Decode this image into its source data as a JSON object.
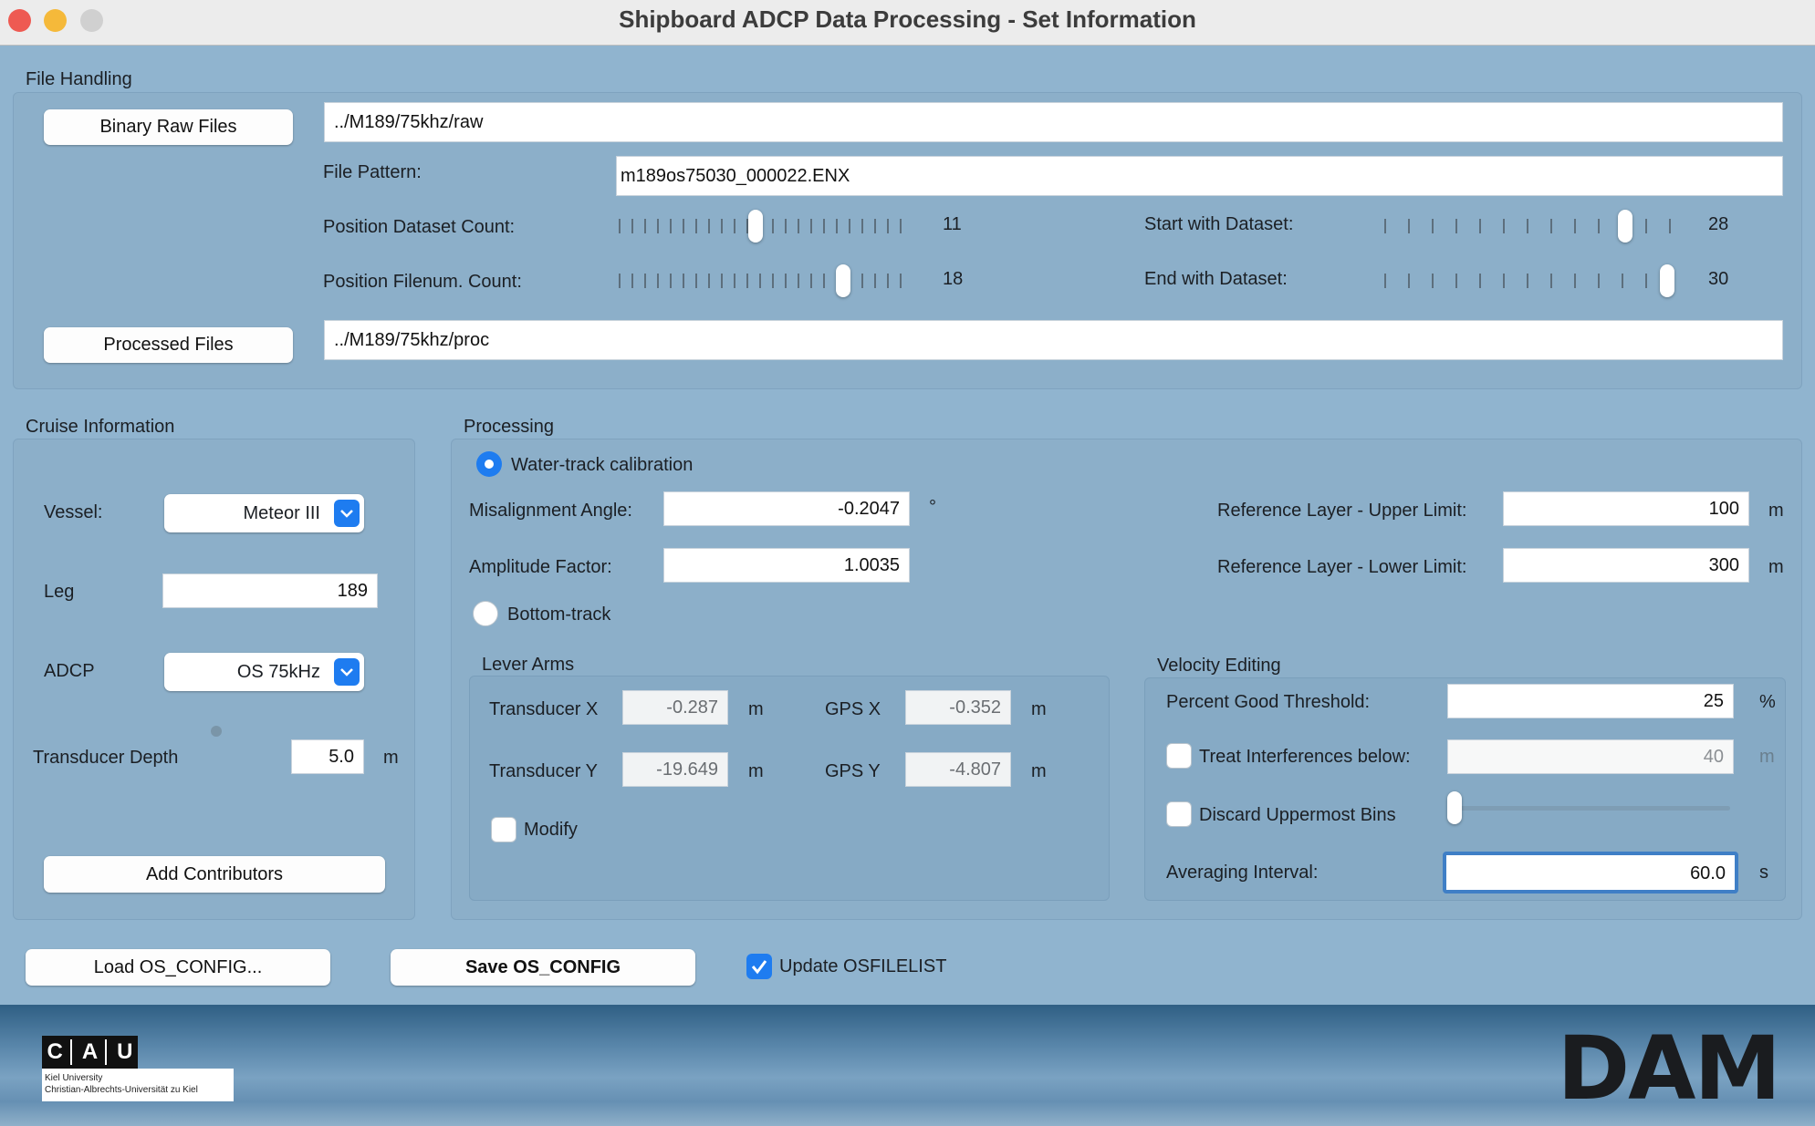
{
  "window": {
    "title": "Shipboard ADCP Data Processing - Set Information"
  },
  "file_handling": {
    "section_label": "File Handling",
    "raw_button": "Binary Raw Files",
    "raw_path": "../M189/75khz/raw",
    "file_pattern_label": "File Pattern:",
    "file_pattern": "m189os75030_000022.ENX",
    "position_dataset_count_label": "Position Dataset Count:",
    "position_dataset_count": "11",
    "position_dataset_count_level": 0.48,
    "position_filenum_count_label": "Position Filenum. Count:",
    "position_filenum_count": "18",
    "position_filenum_count_level": 0.8,
    "start_dataset_label": "Start with Dataset:",
    "start_dataset": "28",
    "start_dataset_level": 0.85,
    "end_dataset_label": "End with Dataset:",
    "end_dataset": "30",
    "end_dataset_level": 1.0,
    "processed_button": "Processed Files",
    "processed_path": "../M189/75khz/proc"
  },
  "cruise": {
    "section_label": "Cruise Information",
    "vessel_label": "Vessel:",
    "vessel": "Meteor III",
    "leg_label": "Leg",
    "leg": "189",
    "adcp_label": "ADCP",
    "adcp": "OS 75kHz",
    "transducer_depth_label": "Transducer Depth",
    "transducer_depth": "5.0",
    "transducer_depth_unit": "m",
    "contributors_button": "Add Contributors"
  },
  "processing": {
    "section_label": "Processing",
    "water_track_label": "Water-track calibration",
    "water_track_selected": true,
    "misalignment_label": "Misalignment Angle:",
    "misalignment": "-0.2047",
    "misalignment_unit": "°",
    "amplitude_label": "Amplitude Factor:",
    "amplitude": "1.0035",
    "ref_upper_label": "Reference Layer - Upper Limit:",
    "ref_upper": "100",
    "ref_lower_label": "Reference Layer - Lower Limit:",
    "ref_lower": "300",
    "ref_unit": "m",
    "bottom_track_label": "Bottom-track",
    "bottom_track_selected": false,
    "lever_arms": {
      "label": "Lever Arms",
      "transducer_x_label": "Transducer X",
      "transducer_x": "-0.287",
      "transducer_y_label": "Transducer Y",
      "transducer_y": "-19.649",
      "gps_x_label": "GPS X",
      "gps_x": "-0.352",
      "gps_y_label": "GPS Y",
      "gps_y": "-4.807",
      "unit": "m",
      "modify_label": "Modify",
      "modify_checked": false
    },
    "velocity_editing": {
      "label": "Velocity Editing",
      "percent_good_label": "Percent Good Threshold:",
      "percent_good": "25",
      "percent_unit": "%",
      "interference_label": "Treat Interferences below:",
      "interference": "40",
      "interference_unit": "m",
      "interference_checked": false,
      "discard_label": "Discard Uppermost Bins",
      "discard_checked": false,
      "discard_level": 0.0,
      "averaging_label": "Averaging Interval:",
      "averaging": "60.0",
      "averaging_unit": "s"
    }
  },
  "bottom_bar": {
    "load_button": "Load OS_CONFIG...",
    "save_button": "Save OS_CONFIG",
    "update_label": "Update OSFILELIST",
    "update_checked": true
  },
  "footer": {
    "cau_letters": [
      "C",
      "A",
      "U"
    ],
    "cau_line1": "Kiel University",
    "cau_line2": "Christian-Albrechts-Universität zu Kiel",
    "dam_logo": "DAM"
  },
  "colors": {
    "accent": "#1e7cf0",
    "background": "#90b4cf",
    "close": "#ee5a52",
    "minimize": "#f5b93a",
    "zoom": "#d0d0d0"
  }
}
